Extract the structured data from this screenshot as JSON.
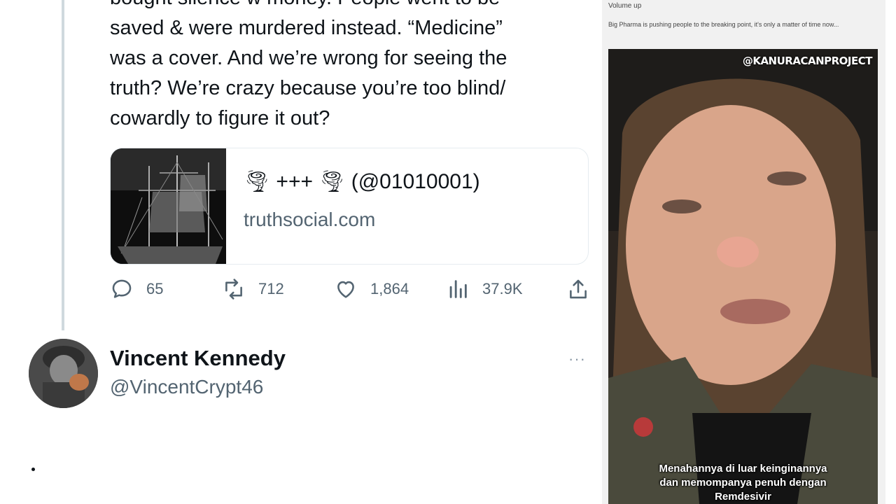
{
  "tweet": {
    "text": "bought silence w money. People went to be\nsaved & were murdered instead. “Medicine”\nwas a cover. And we’re wrong for seeing the\ntruth? We’re crazy because you’re too blind/\ncowardly to figure it out?",
    "card": {
      "title": "🌪 +++ 🌪 (@01010001)",
      "domain": "truthsocial.com",
      "thumb_icon": "ship-image"
    },
    "actions": {
      "replies": "65",
      "retweets": "712",
      "likes": "1,864",
      "views": "37.9K"
    }
  },
  "reply_user": {
    "name": "Vincent Kennedy",
    "handle": "@VincentCrypt46",
    "more": "···"
  },
  "right_panel": {
    "volume_label": "Volume up",
    "caption": "Big Pharma is pushing people to the breaking point, it's only a matter of time now...",
    "video": {
      "watermark": "@KANURACANPROJECT",
      "subtitle": "Menahannya di luar keinginannya\ndan memompanya penuh dengan\nRemdesivir"
    }
  },
  "colors": {
    "text": "#0f1419",
    "secondary": "#536471",
    "border": "#e6ecf0",
    "thread_line": "#cfd9de"
  }
}
